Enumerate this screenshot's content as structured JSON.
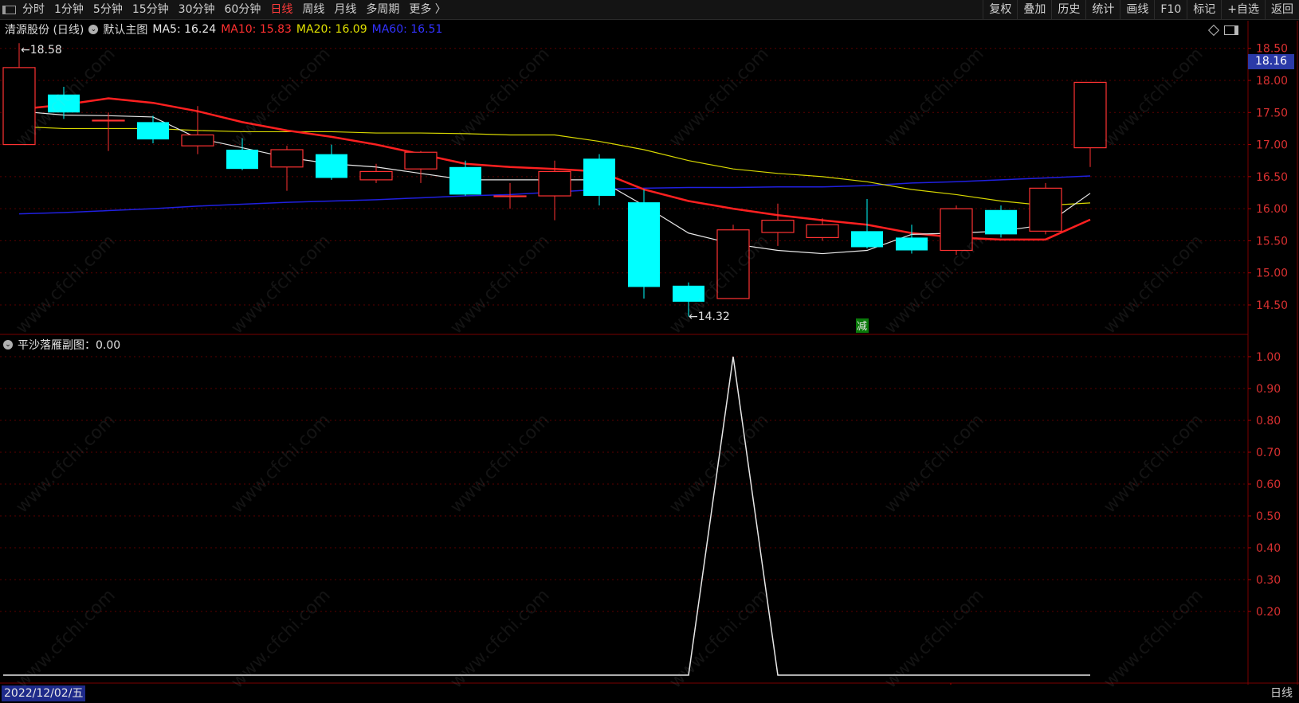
{
  "toolbar": {
    "periods": [
      "分时",
      "1分钟",
      "5分钟",
      "15分钟",
      "30分钟",
      "60分钟",
      "日线",
      "周线",
      "月线",
      "多周期",
      "更多 〉"
    ],
    "active_period": "日线",
    "right_items": [
      "复权",
      "叠加",
      "历史",
      "统计",
      "画线",
      "F10",
      "标记",
      "+自选",
      "返回"
    ]
  },
  "info": {
    "stock": "清源股份 (日线)",
    "template": "默认主图",
    "ma5": "MA5: 16.24",
    "ma10": "MA10: 15.83",
    "ma20": "MA20: 16.09",
    "ma60": "MA60: 16.51"
  },
  "sub": {
    "title": "平沙落雁副图：0.00"
  },
  "price_axis": [
    "18.50",
    "18.00",
    "17.50",
    "17.00",
    "16.50",
    "16.00",
    "15.50",
    "15.00",
    "14.50"
  ],
  "current_price": "18.16",
  "sub_axis": [
    "1.00",
    "0.90",
    "0.80",
    "0.70",
    "0.60",
    "0.50",
    "0.40",
    "0.30",
    "0.20"
  ],
  "annotations": {
    "high": "18.58",
    "low": "14.32",
    "signal": "减",
    "month_marker": "1"
  },
  "status": {
    "date": "2022/12/02/五",
    "period": "日线"
  },
  "watermark": "www.cfchi.com",
  "colors": {
    "up": "#ff3232",
    "down": "#00ffff",
    "ma5": "#e8e8e8",
    "ma10": "#ff2020",
    "ma20": "#d8d800",
    "ma60": "#2020e0",
    "signal_bg": "#0a7a0a"
  },
  "chart_data": [
    {
      "type": "candlestick",
      "title": "清源股份 (日线)",
      "y_range": [
        14.25,
        18.7
      ],
      "candles": [
        {
          "o": 17.0,
          "c": 18.2,
          "h": 18.58,
          "l": 17.0
        },
        {
          "o": 17.78,
          "c": 17.5,
          "h": 17.9,
          "l": 17.4
        },
        {
          "o": 17.38,
          "c": 17.38,
          "h": 17.5,
          "l": 16.9
        },
        {
          "o": 17.35,
          "c": 17.08,
          "h": 17.45,
          "l": 17.02
        },
        {
          "o": 16.98,
          "c": 17.15,
          "h": 17.6,
          "l": 16.85
        },
        {
          "o": 16.92,
          "c": 16.62,
          "h": 17.1,
          "l": 16.6
        },
        {
          "o": 16.65,
          "c": 16.92,
          "h": 16.98,
          "l": 16.28
        },
        {
          "o": 16.85,
          "c": 16.48,
          "h": 17.0,
          "l": 16.45
        },
        {
          "o": 16.45,
          "c": 16.58,
          "h": 16.7,
          "l": 16.4
        },
        {
          "o": 16.62,
          "c": 16.88,
          "h": 16.9,
          "l": 16.4
        },
        {
          "o": 16.65,
          "c": 16.22,
          "h": 16.75,
          "l": 16.2
        },
        {
          "o": 16.2,
          "c": 16.2,
          "h": 16.4,
          "l": 16.0
        },
        {
          "o": 16.2,
          "c": 16.58,
          "h": 16.75,
          "l": 15.82
        },
        {
          "o": 16.78,
          "c": 16.2,
          "h": 16.85,
          "l": 16.05
        },
        {
          "o": 16.1,
          "c": 14.78,
          "h": 16.3,
          "l": 14.6
        },
        {
          "o": 14.8,
          "c": 14.55,
          "h": 14.85,
          "l": 14.32
        },
        {
          "o": 14.6,
          "c": 15.67,
          "h": 15.75,
          "l": 14.6
        },
        {
          "o": 15.63,
          "c": 15.82,
          "h": 16.08,
          "l": 15.42
        },
        {
          "o": 15.55,
          "c": 15.75,
          "h": 15.85,
          "l": 15.5
        },
        {
          "o": 15.65,
          "c": 15.4,
          "h": 16.15,
          "l": 15.38
        },
        {
          "o": 15.55,
          "c": 15.35,
          "h": 15.75,
          "l": 15.3
        },
        {
          "o": 15.35,
          "c": 16.0,
          "h": 16.05,
          "l": 15.28
        },
        {
          "o": 15.98,
          "c": 15.6,
          "h": 16.05,
          "l": 15.55
        },
        {
          "o": 15.65,
          "c": 16.32,
          "h": 16.4,
          "l": 15.6
        },
        {
          "o": 16.95,
          "c": 17.97,
          "h": 17.97,
          "l": 16.65
        }
      ],
      "ma5": [
        17.52,
        17.46,
        17.45,
        17.43,
        17.1,
        16.95,
        16.8,
        16.7,
        16.65,
        16.55,
        16.45,
        16.45,
        16.45,
        16.45,
        16.05,
        15.62,
        15.45,
        15.35,
        15.3,
        15.35,
        15.6,
        15.62,
        15.65,
        15.75,
        16.24
      ],
      "ma10": [
        17.55,
        17.62,
        17.72,
        17.65,
        17.52,
        17.35,
        17.22,
        17.12,
        17.0,
        16.85,
        16.7,
        16.65,
        16.62,
        16.58,
        16.3,
        16.12,
        16.0,
        15.9,
        15.82,
        15.75,
        15.62,
        15.55,
        15.52,
        15.52,
        15.83
      ],
      "ma20": [
        17.28,
        17.25,
        17.25,
        17.25,
        17.22,
        17.2,
        17.2,
        17.2,
        17.18,
        17.18,
        17.17,
        17.15,
        17.15,
        17.05,
        16.92,
        16.75,
        16.62,
        16.55,
        16.5,
        16.42,
        16.3,
        16.22,
        16.12,
        16.05,
        16.09
      ],
      "ma60": [
        15.92,
        15.94,
        15.97,
        16.0,
        16.04,
        16.07,
        16.1,
        16.12,
        16.14,
        16.17,
        16.2,
        16.22,
        16.26,
        16.3,
        16.32,
        16.33,
        16.33,
        16.34,
        16.34,
        16.36,
        16.4,
        16.42,
        16.45,
        16.48,
        16.51
      ]
    },
    {
      "type": "line",
      "title": "平沙落雁副图",
      "y_range": [
        0,
        1.0
      ],
      "values": [
        0,
        0,
        0,
        0,
        0,
        0,
        0,
        0,
        0,
        0,
        0,
        0,
        0,
        0,
        0,
        0,
        1,
        0,
        0,
        0,
        0,
        0,
        0,
        0,
        0
      ]
    }
  ]
}
